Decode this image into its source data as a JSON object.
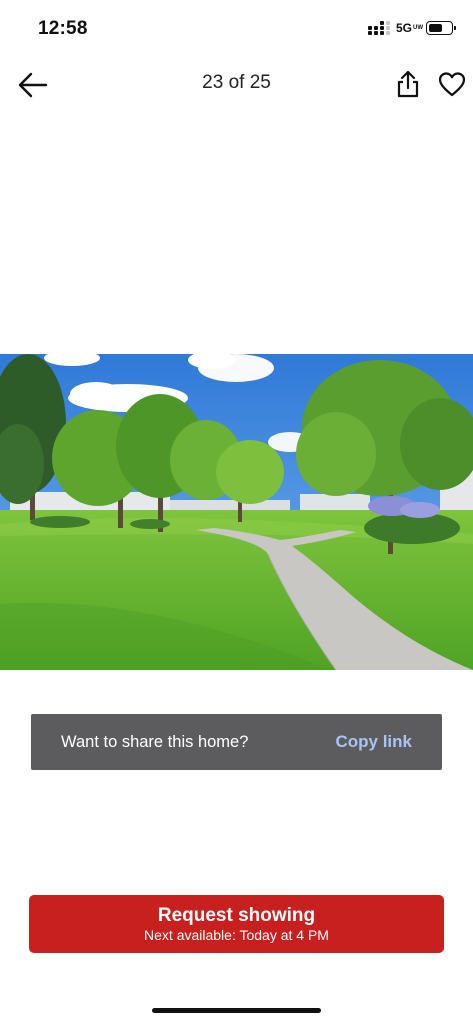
{
  "status_bar": {
    "time": "12:58",
    "network": "5G",
    "network_suffix": "UW",
    "battery_level": 0.65
  },
  "nav": {
    "back_icon": "arrow-left-icon",
    "title": "23 of 25",
    "share_icon": "share-icon",
    "favorite_icon": "heart-icon"
  },
  "photo": {
    "subject": "photo"
  },
  "share_banner": {
    "text": "Want to share this home?",
    "action_label": "Copy link"
  },
  "cta": {
    "title": "Request showing",
    "subtitle": "Next available: Today at 4 PM",
    "color": "#c8201f"
  },
  "colors": {
    "banner_bg": "#5c5c5e",
    "link_color": "#a9c3f3"
  }
}
